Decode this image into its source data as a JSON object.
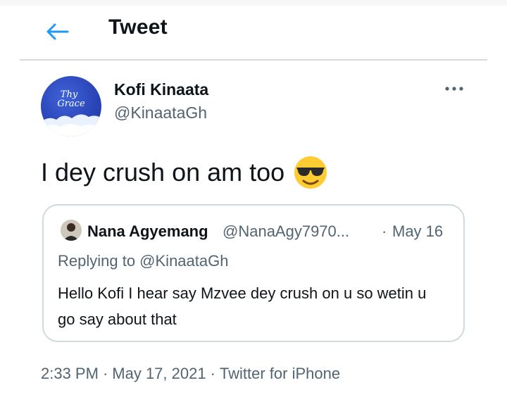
{
  "header": {
    "back_icon": "arrow-left-icon",
    "title": "Tweet"
  },
  "tweet": {
    "author_name": "Kofi Kinaata",
    "author_handle": "@KinaataGh",
    "avatar_text_line1": "Thy",
    "avatar_text_line2": "Grace",
    "text": "I dey crush on am too",
    "emoji": "smiling-face-with-sunglasses-icon",
    "more_icon": "more-options-icon",
    "time": "2:33 PM",
    "date": "May 17, 2021",
    "source": "Twitter for iPhone",
    "separator": "·"
  },
  "quoted_tweet": {
    "author_name": "Nana Agyemang",
    "author_handle": "@NanaAgy7970...",
    "separator": "·",
    "date": "May 16",
    "replying_to": "Replying to @KinaataGh",
    "text": "Hello Kofi I hear say Mzvee dey crush on u so wetin u go say about that"
  },
  "colors": {
    "accent": "#1d9bf0",
    "secondary_text": "#536471",
    "border": "#cfd9de"
  }
}
